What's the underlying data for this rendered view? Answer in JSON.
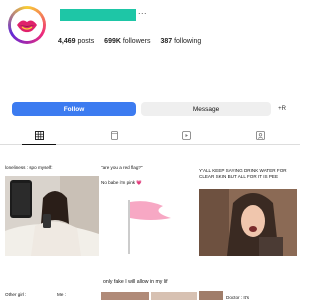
{
  "profile": {
    "more_label": "...",
    "stats": [
      {
        "value": "4,469",
        "label": "posts"
      },
      {
        "value": "699K",
        "label": "followers"
      },
      {
        "value": "387",
        "label": "following"
      }
    ]
  },
  "actions": {
    "follow_label": "Follow",
    "message_label": "Message",
    "add_label": "+R"
  },
  "tabs": [
    {
      "name": "grid",
      "icon": "grid-icon",
      "active": true
    },
    {
      "name": "reels",
      "icon": "reels-icon",
      "active": false
    },
    {
      "name": "clips",
      "icon": "play-icon",
      "active": false
    },
    {
      "name": "tagged",
      "icon": "tagged-icon",
      "active": false
    }
  ],
  "posts": [
    {
      "caption": "loneliness : spo myself:"
    },
    {
      "caption_top": "\"are you a red flag?\"",
      "caption_mid": "No babe i'm pink 💗"
    },
    {
      "caption": "Y'ALL KEEP SAYING DRINK WATER FOR CLEAR SKIN BUT ALL FOR IT IS PEE"
    },
    {
      "caption": "Other girl :",
      "caption_b": "Me :"
    },
    {
      "caption": "only fake I will allow in my lif"
    },
    {
      "caption": "Doctor : It's"
    }
  ],
  "colors": {
    "follow": "#3c7bf0",
    "message_bg": "#efefef",
    "username_redaction": "#1ec6a6",
    "flag": "#f7a8c4"
  }
}
